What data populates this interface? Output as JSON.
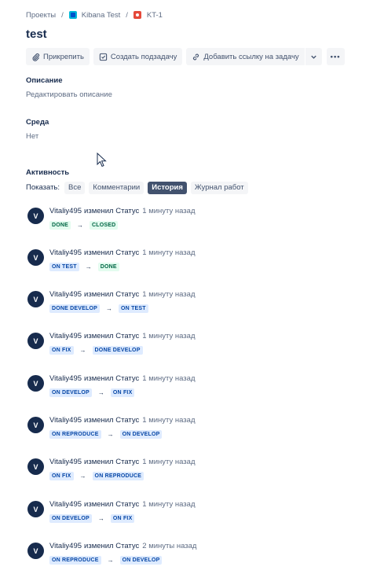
{
  "breadcrumb": {
    "projects": "Проекты",
    "project": "Kibana Test",
    "issue": "KT-1",
    "separator": "/"
  },
  "issue": {
    "title": "test"
  },
  "toolbar": {
    "attach": "Прикрепить",
    "create_subtask": "Создать подзадачу",
    "add_link": "Добавить ссылку на задачу",
    "more": "•••"
  },
  "description": {
    "label": "Описание",
    "placeholder": "Редактировать описание"
  },
  "environment": {
    "label": "Среда",
    "value": "Нет"
  },
  "activity": {
    "label": "Активность",
    "show_label": "Показать:",
    "filters": [
      "Все",
      "Комментарии",
      "История",
      "Журнал работ"
    ],
    "active_filter": "История",
    "entries": [
      {
        "avatar": "V",
        "user": "Vitaliy495",
        "action": "изменил Статус",
        "time": "1 минуту назад",
        "from": "DONE",
        "from_color": "green",
        "to": "CLOSED",
        "to_color": "green"
      },
      {
        "avatar": "V",
        "user": "Vitaliy495",
        "action": "изменил Статус",
        "time": "1 минуту назад",
        "from": "ON TEST",
        "from_color": "blue",
        "to": "DONE",
        "to_color": "green"
      },
      {
        "avatar": "V",
        "user": "Vitaliy495",
        "action": "изменил Статус",
        "time": "1 минуту назад",
        "from": "DONE DEVELOP",
        "from_color": "blue",
        "to": "ON TEST",
        "to_color": "blue"
      },
      {
        "avatar": "V",
        "user": "Vitaliy495",
        "action": "изменил Статус",
        "time": "1 минуту назад",
        "from": "ON FIX",
        "from_color": "blue",
        "to": "DONE DEVELOP",
        "to_color": "blue"
      },
      {
        "avatar": "V",
        "user": "Vitaliy495",
        "action": "изменил Статус",
        "time": "1 минуту назад",
        "from": "ON DEVELOP",
        "from_color": "blue",
        "to": "ON FIX",
        "to_color": "blue"
      },
      {
        "avatar": "V",
        "user": "Vitaliy495",
        "action": "изменил Статус",
        "time": "1 минуту назад",
        "from": "ON REPRODUCE",
        "from_color": "blue",
        "to": "ON DEVELOP",
        "to_color": "blue"
      },
      {
        "avatar": "V",
        "user": "Vitaliy495",
        "action": "изменил Статус",
        "time": "1 минуту назад",
        "from": "ON FIX",
        "from_color": "blue",
        "to": "ON REPRODUCE",
        "to_color": "blue"
      },
      {
        "avatar": "V",
        "user": "Vitaliy495",
        "action": "изменил Статус",
        "time": "1 минуту назад",
        "from": "ON DEVELOP",
        "from_color": "blue",
        "to": "ON FIX",
        "to_color": "blue"
      },
      {
        "avatar": "V",
        "user": "Vitaliy495",
        "action": "изменил Статус",
        "time": "2 минуты назад",
        "from": "ON REPRODUCE",
        "from_color": "blue",
        "to": "ON DEVELOP",
        "to_color": "blue"
      }
    ],
    "arrow": "→"
  },
  "colors": {
    "text": "#172b4d",
    "subtle": "#5e6c84",
    "button_bg": "#f4f5f7",
    "active_filter_bg": "#42526e",
    "avatar_bg": "#172b4d"
  }
}
